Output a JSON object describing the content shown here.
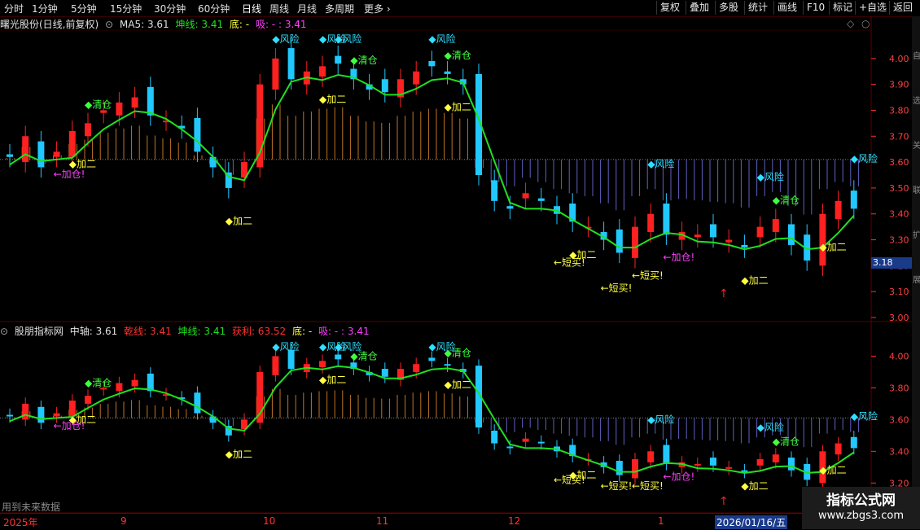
{
  "toolbar": {
    "timeframes": [
      "分时",
      "1分钟",
      "5分钟",
      "15分钟",
      "30分钟",
      "60分钟",
      "日线",
      "周线",
      "月线",
      "多周期",
      "更多"
    ],
    "active": "日线",
    "right_buttons": [
      "复权",
      "叠加",
      "多股",
      "统计",
      "画线",
      "F10",
      "标记",
      "+自选",
      "返回"
    ]
  },
  "panel1": {
    "title": "曙光股份(日线,前复权)",
    "ma_label": "MA5: 3.61",
    "kun_label": "坤线: 3.41",
    "di_label": "底: -",
    "xi_label": "吸: - : 3.41",
    "y_ticks": [
      "4.00",
      "3.90",
      "3.80",
      "3.70",
      "3.60",
      "3.50",
      "3.40",
      "3.30",
      "3.20",
      "3.10",
      "3.00"
    ],
    "price_tag": "3.18",
    "labels": [
      "风险",
      "风险",
      "风险",
      "风险",
      "风险",
      "风险",
      "风险",
      "清仓",
      "清仓",
      "清仓",
      "清仓",
      "加二",
      "加二",
      "加二",
      "加二",
      "加二",
      "加二",
      "加二",
      "加仓!",
      "加仓!",
      "短买!",
      "短买!",
      "短买!"
    ]
  },
  "panel2": {
    "title": "股朋指标网",
    "zhong": "中轴: 3.61",
    "qian": "乾线: 3.41",
    "kun": "坤线: 3.41",
    "huoli": "获利: 63.52",
    "di": "底: -",
    "xi": "吸: - : 3.41",
    "y_ticks": [
      "4.00",
      "3.80",
      "3.60",
      "3.40",
      "3.20"
    ],
    "footer_note": "用到未来数据"
  },
  "date_axis": [
    "2025年",
    "9",
    "10",
    "11",
    "12",
    "1",
    "2026/01/16/五"
  ],
  "watermark": {
    "title": "指标公式网",
    "url": "www.zbgs3.com"
  },
  "right_strip_text": [
    "自",
    "选",
    "关",
    "联",
    "扩",
    "展"
  ],
  "colors": {
    "up": "#ff2020",
    "down": "#20c8ff",
    "kun_line": "#20e020",
    "zhong_line": "#ff9900",
    "grid": "#5a0000"
  },
  "chart_data": {
    "type": "candlestick",
    "series": [
      {
        "name": "曙光股份 close",
        "values": [
          3.62,
          3.7,
          3.58,
          3.64,
          3.72,
          3.75,
          3.8,
          3.83,
          3.85,
          3.78,
          3.76,
          3.73,
          3.64,
          3.58,
          3.5,
          3.6,
          3.9,
          4.0,
          3.92,
          3.95,
          3.97,
          3.98,
          3.92,
          3.88,
          3.87,
          3.92,
          3.95,
          3.97,
          3.94,
          3.9,
          3.55,
          3.45,
          3.42,
          3.48,
          3.45,
          3.4,
          3.37,
          3.35,
          3.3,
          3.25,
          3.35,
          3.4,
          3.32,
          3.33,
          3.32,
          3.31,
          3.3,
          3.27,
          3.35,
          3.38,
          3.28,
          3.22,
          3.4,
          3.45,
          3.42
        ]
      }
    ],
    "ylim": [
      3.0,
      4.1
    ]
  }
}
